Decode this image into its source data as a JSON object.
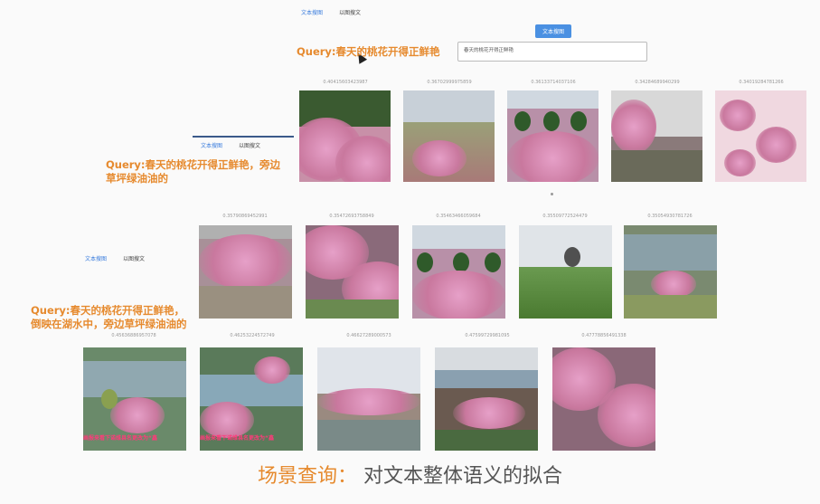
{
  "tabs": {
    "text_search": "文本搜图",
    "image_search": "以图搜文"
  },
  "search": {
    "button_label": "文本搜图",
    "input_value": "春天的桃花开得正鲜艳"
  },
  "queries": {
    "q1": "Query:春天的桃花开得正鲜艳",
    "q2": "Query:春天的桃花开得正鲜艳，旁边\n草坪绿油油的",
    "q3": "Query:春天的桃花开得正鲜艳，\n倒映在湖水中，旁边草坪绿油油的"
  },
  "rows": [
    {
      "scores": [
        "0.40415603423987",
        "0.36702999975859",
        "0.36133714037106",
        "0.34284689940299",
        "0.34019284781266"
      ]
    },
    {
      "scores": [
        "0.35790869452991",
        "0.35472693758849",
        "0.35463466059684",
        "0.35509772524479",
        "0.35054930781726"
      ]
    },
    {
      "scores": [
        "0.45636886957078",
        "0.46253224572749",
        "0.46627289000573",
        "0.47599729981095",
        "0.47778856491338"
      ]
    }
  ],
  "overlays": {
    "row3_img1": "画报来看下诺维县名更改为“鑫",
    "row3_img2": "画报来看下诺维县名更改为“鑫"
  },
  "caption": {
    "highlight": "场景查询：",
    "rest": "对文本整体语义的拟合"
  },
  "colors": {
    "accent": "#e68a2e",
    "button": "#4a90e2"
  }
}
